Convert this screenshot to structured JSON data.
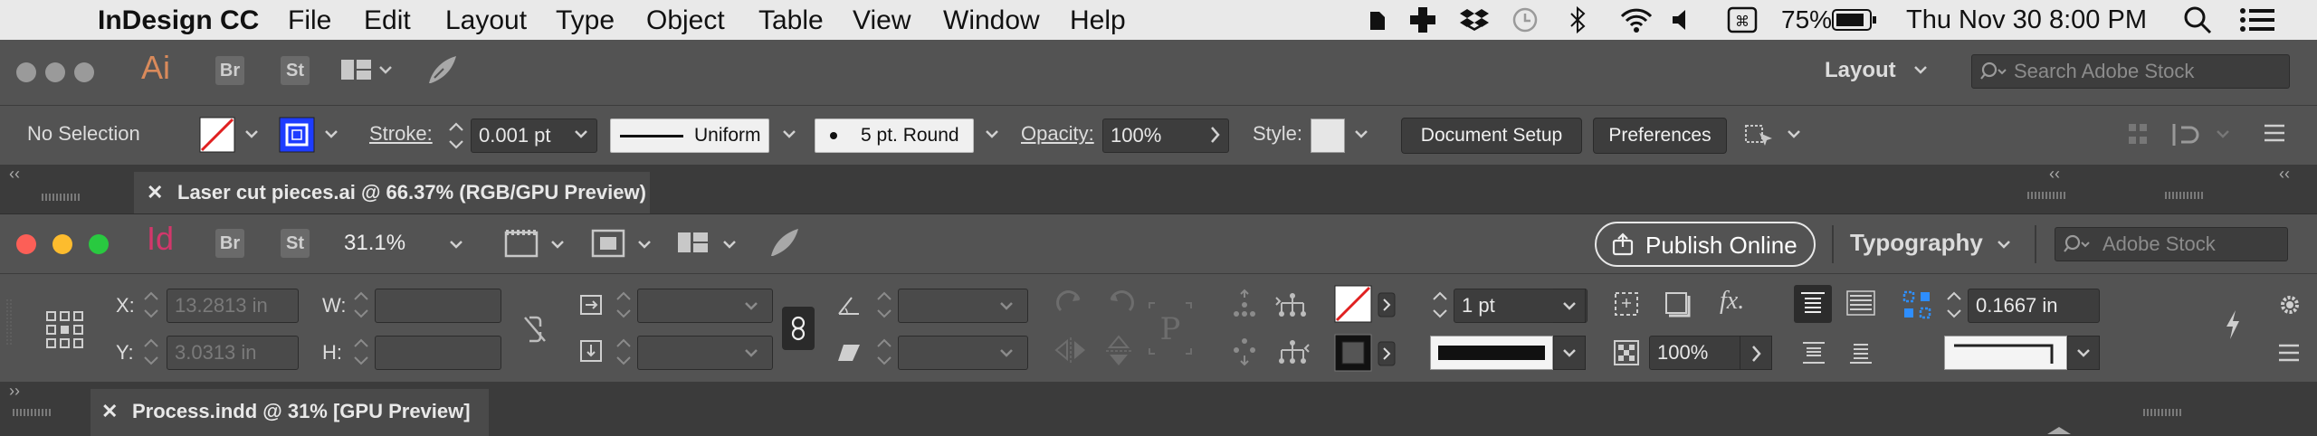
{
  "menubar": {
    "app_name": "InDesign CC",
    "items": [
      "File",
      "Edit",
      "Layout",
      "Type",
      "Object",
      "Table",
      "View",
      "Window",
      "Help"
    ],
    "battery": "75%",
    "datetime": "Thu Nov 30  8:00 PM"
  },
  "ai_app_bar": {
    "app_icon": "Ai",
    "bridge": "Br",
    "stock": "St",
    "workspace": "Layout",
    "search_placeholder": "Search Adobe Stock"
  },
  "ai_control": {
    "selection": "No Selection",
    "stroke_label": "Stroke:",
    "stroke_value": "0.001 pt",
    "stroke_profile": "Uniform",
    "brush": "5 pt. Round",
    "opacity_label": "Opacity:",
    "opacity_value": "100%",
    "style_label": "Style:",
    "document_setup": "Document Setup",
    "preferences": "Preferences"
  },
  "ai_tab": {
    "title": "Laser cut pieces.ai @ 66.37% (RGB/GPU Preview)"
  },
  "id_app_bar": {
    "app_icon": "Id",
    "bridge": "Br",
    "stock": "St",
    "zoom": "31.1%",
    "publish": "Publish Online",
    "workspace": "Typography",
    "search_placeholder": "Adobe Stock"
  },
  "id_control": {
    "x_label": "X:",
    "x_value": "13.2813 in",
    "y_label": "Y:",
    "y_value": "3.0313 in",
    "w_label": "W:",
    "h_label": "H:",
    "stroke_weight": "1 pt",
    "opacity": "100%",
    "gutter": "0.1667 in"
  },
  "id_tab": {
    "title": "Process.indd @ 31% [GPU Preview]"
  },
  "colors": {
    "menubar": "#e9e9e9",
    "panel": "#535353",
    "ai_orange": "#d98a5b",
    "id_pink": "#d2376b",
    "dot_red": "#fc5f57",
    "dot_yellow": "#fdbc2e",
    "dot_green": "#29c940"
  }
}
